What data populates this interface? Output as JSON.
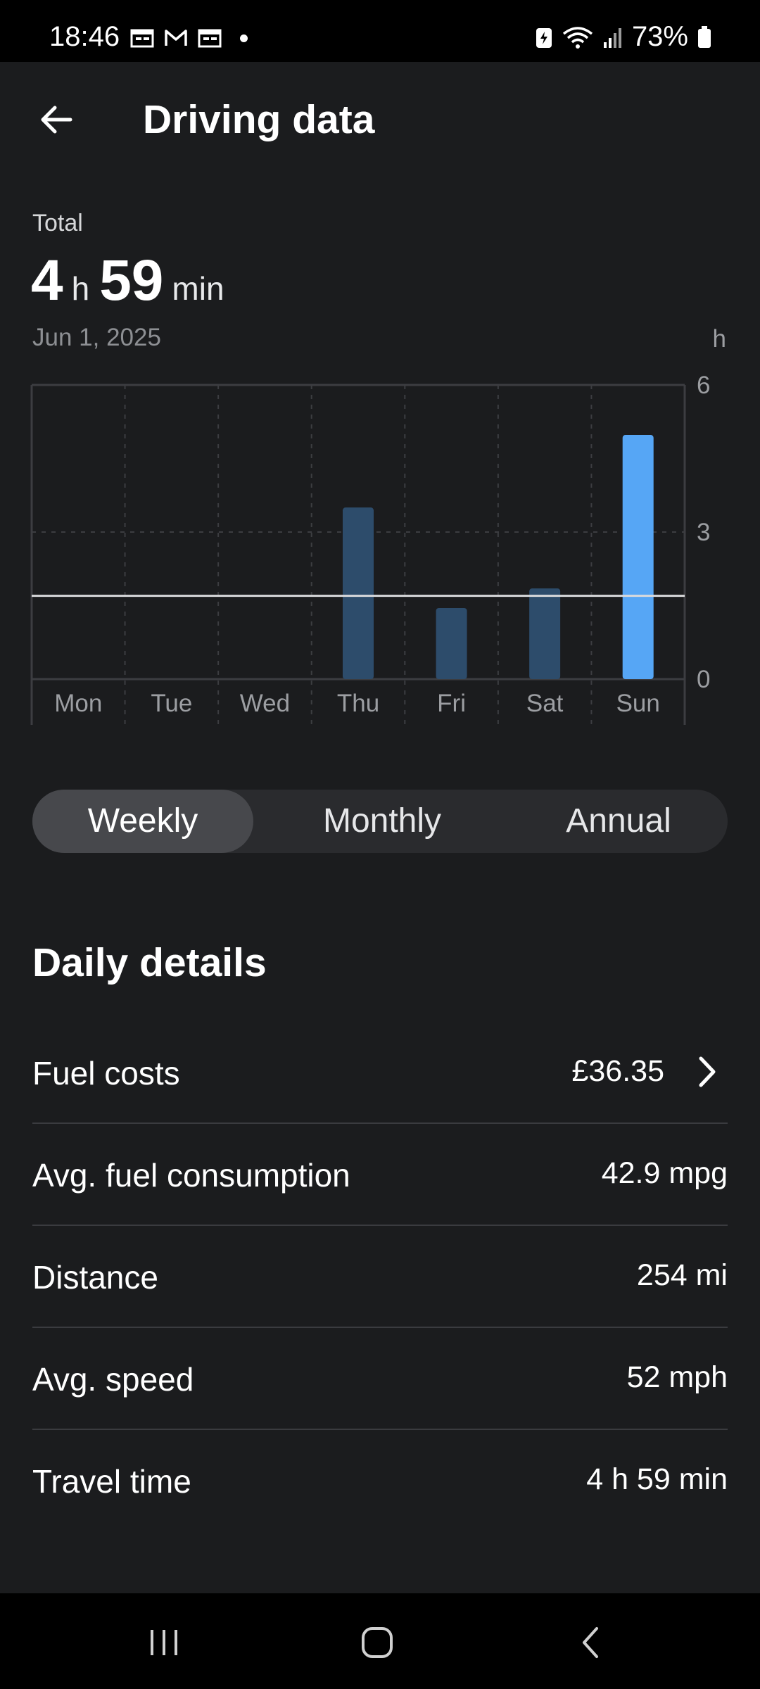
{
  "status_bar": {
    "time": "18:46",
    "battery_percent": "73%",
    "icons_left": [
      "calendar-icon",
      "gmail-icon",
      "calendar-icon",
      "notification-dot"
    ],
    "icons_right": [
      "battery-saver-icon",
      "wifi-icon",
      "signal-icon",
      "battery-icon"
    ]
  },
  "header": {
    "title": "Driving data",
    "back_icon": "arrow-left-icon"
  },
  "summary": {
    "label": "Total",
    "hours": "4",
    "hours_unit": "h",
    "minutes": "59",
    "minutes_unit": "min",
    "date": "Jun 1, 2025"
  },
  "chart_data": {
    "type": "bar",
    "categories": [
      "Mon",
      "Tue",
      "Wed",
      "Thu",
      "Fri",
      "Sat",
      "Sun"
    ],
    "values": [
      0,
      0,
      0,
      3.5,
      1.45,
      1.85,
      4.98
    ],
    "highlighted_category": "Sun",
    "average_line": 1.7,
    "ylabel": "h",
    "yticks": [
      "0",
      "3",
      "6"
    ],
    "ylim": [
      0,
      6
    ],
    "grid": true,
    "axis_position": "right",
    "colors": {
      "bar": "#2d4c6b",
      "bar_highlight": "#56a6f5",
      "average_line": "#d9dadc",
      "grid": "#3c3d41"
    }
  },
  "period_tabs": {
    "items": [
      {
        "label": "Weekly",
        "active": true
      },
      {
        "label": "Monthly",
        "active": false
      },
      {
        "label": "Annual",
        "active": false
      }
    ]
  },
  "details": {
    "title": "Daily details",
    "rows": [
      {
        "label": "Fuel costs",
        "value": "£36.35",
        "has_chevron": true
      },
      {
        "label": "Avg. fuel consumption",
        "value": "42.9 mpg",
        "has_chevron": false
      },
      {
        "label": "Distance",
        "value": "254 mi",
        "has_chevron": false
      },
      {
        "label": "Avg. speed",
        "value": "52 mph",
        "has_chevron": false
      },
      {
        "label": "Travel time",
        "value": "4 h 59 min",
        "has_chevron": false
      }
    ]
  },
  "nav_bar": {
    "buttons": [
      "recents-icon",
      "home-icon",
      "back-icon"
    ]
  }
}
